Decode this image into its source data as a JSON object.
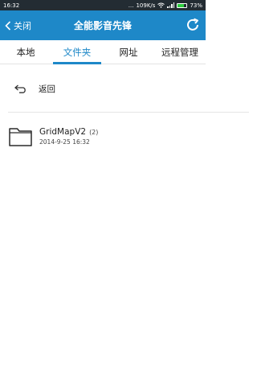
{
  "status_bar": {
    "time": "16:32",
    "dots": "...",
    "network_speed": "109K/s",
    "battery_percent": "73%",
    "battery_level": 0.73
  },
  "header": {
    "back_label": "关闭",
    "title": "全能影音先锋"
  },
  "tabs": [
    {
      "label": "本地",
      "active": false
    },
    {
      "label": "文件夹",
      "active": true
    },
    {
      "label": "网址",
      "active": false
    },
    {
      "label": "远程管理",
      "active": false
    }
  ],
  "list": {
    "return_label": "返回",
    "folders": [
      {
        "name": "GridMapV2",
        "count": "(2)",
        "date": "2014-9-25 16:32"
      }
    ]
  },
  "colors": {
    "accent": "#1e88c8",
    "status_bar": "#232c33"
  }
}
